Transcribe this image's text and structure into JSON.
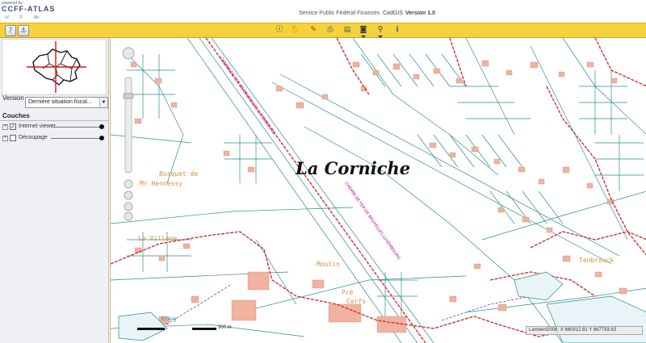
{
  "header": {
    "powered_by": "powered by",
    "brand": "CCFF-ATLAS",
    "languages": [
      "nl",
      "fr",
      "de"
    ],
    "ministry": "Service Public Fédéral Finances",
    "app_name": "CadGIS",
    "version": "Version   1.0"
  },
  "toolbar": {
    "left_buttons": [
      "help-icon",
      "anchor-icon"
    ],
    "tools": [
      "information-icon",
      "pan-icon",
      "edit-icon",
      "print-icon",
      "document-icon",
      "camera-icon",
      "search-icon",
      "info-icon"
    ]
  },
  "left_panel": {
    "version_label": "Version",
    "version_value": "Dernière situation fiscal...",
    "layers_title": "Couches",
    "layers": [
      {
        "label": "Internet viewer",
        "checked": true
      },
      {
        "label": "Découpage",
        "checked": false
      }
    ]
  },
  "map": {
    "overlay_title": "La Corniche",
    "place_labels": [
      "Bosquet de",
      "Mr Hennessy",
      "Le Village",
      "Moulin",
      "Pré",
      "Cerfs",
      "Etang",
      "Tenbrouck"
    ],
    "road_label": "CHEMIN DE FER DE BRUXELLES LUXEMBOURG",
    "scale_label": "300 m",
    "coordinates": "Lambert2008: X 660912.81  Y 667753.63"
  },
  "colors": {
    "toolbar": "#f5d23c",
    "parcel_line": "#2a8f86",
    "building": "#f1b2a0",
    "boundary": "#cc3333",
    "place_label": "#d68f3c"
  }
}
